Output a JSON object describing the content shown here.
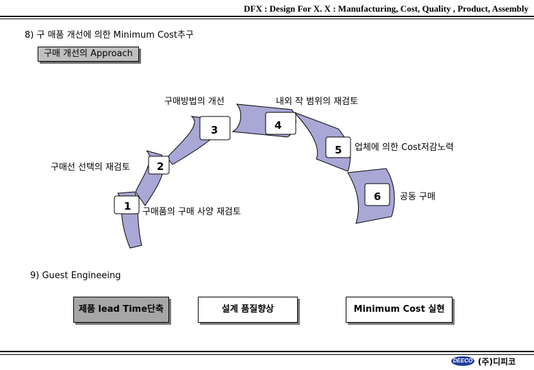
{
  "header": {
    "title": "DFX : Design For X. X : Manufacturing, Cost, Quality , Product, Assembly"
  },
  "section8": {
    "title": "8) 구 매품 개선에 의한 Minimum Cost추구",
    "approach_label": "구매 개선의 Approach",
    "steps": [
      {
        "number": "1",
        "label": "구매품의 구매 사양 재검토"
      },
      {
        "number": "2",
        "label": "구매선 선택의 재검토"
      },
      {
        "number": "3",
        "label": "구매방법의 개선"
      },
      {
        "number": "4",
        "label": "내외 작 범위의 재검토"
      },
      {
        "number": "5",
        "label": "업체에 의한 Cost저감노력"
      },
      {
        "number": "6",
        "label": "공동 구매"
      }
    ]
  },
  "section9": {
    "title": "9) Guest Engineeing",
    "items": [
      {
        "label": "제품 lead Time단축"
      },
      {
        "label": "설계 품질향상"
      },
      {
        "label": "Minimum  Cost 실현"
      }
    ]
  },
  "footer": {
    "logo_text": "DEECO",
    "company": "(주)디피코"
  },
  "colors": {
    "segment_fill": "#a9a7d6",
    "approach_fill": "#bfbfbf",
    "pill_grey": "#a6a6a6",
    "logo_blue": "#1f3f9a"
  }
}
